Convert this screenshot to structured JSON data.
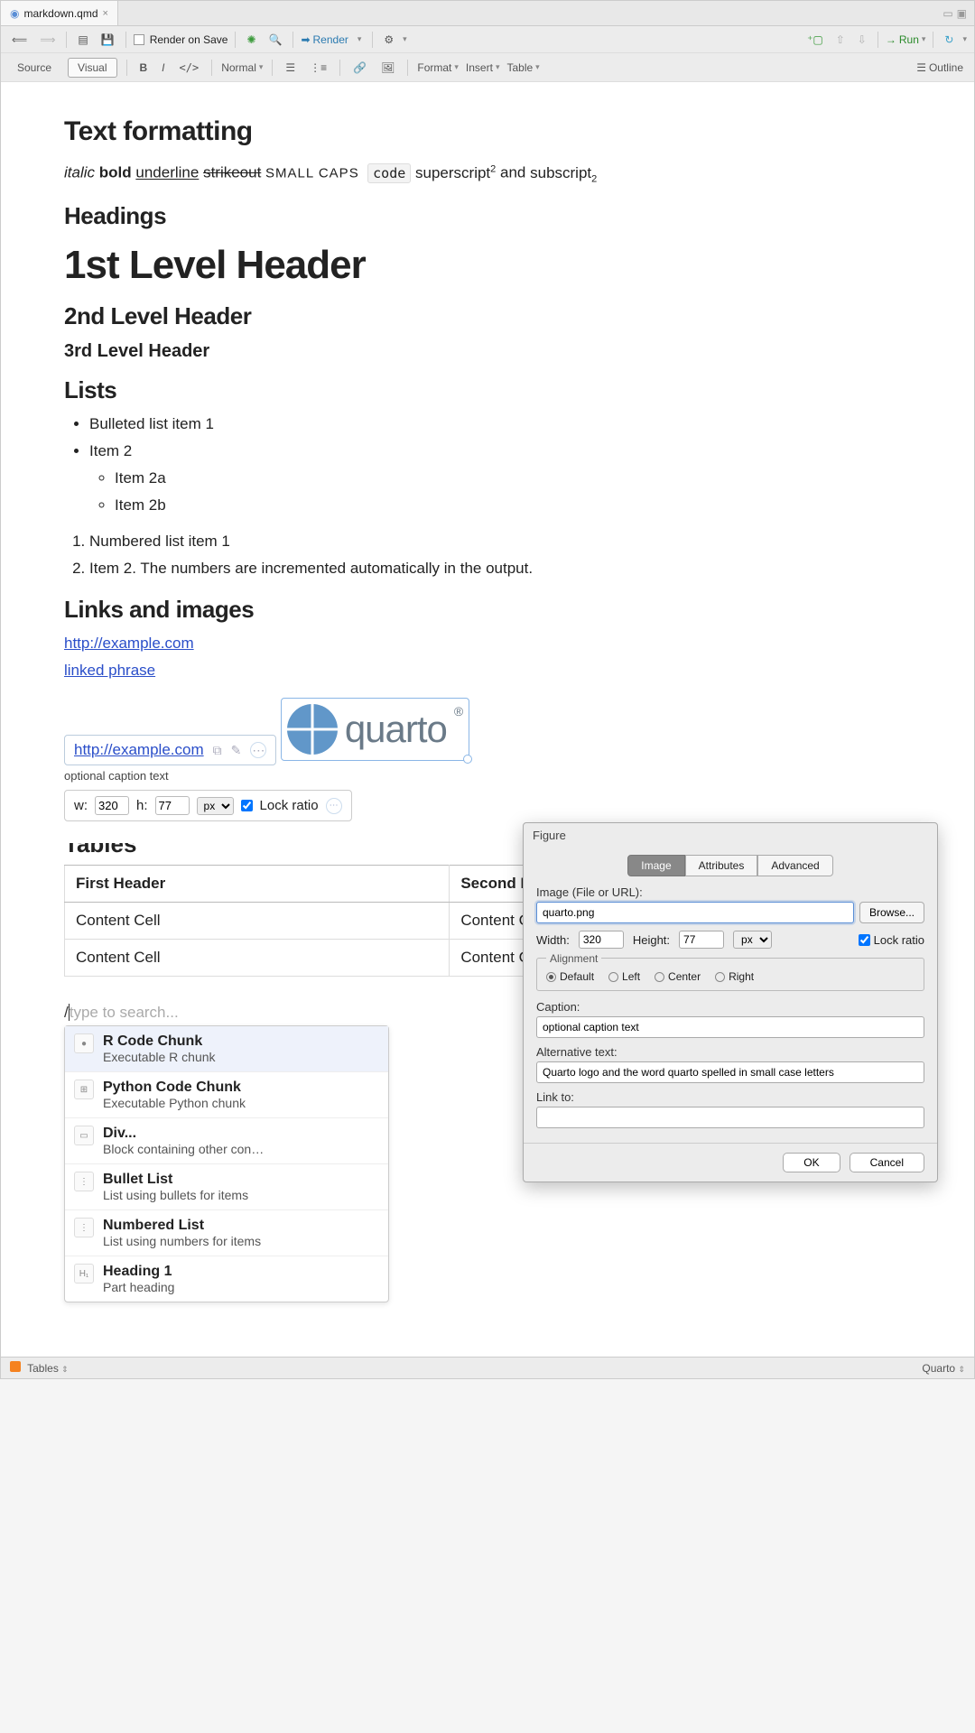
{
  "tab": {
    "filename": "markdown.qmd"
  },
  "toolbar1": {
    "render_on_save": "Render on Save",
    "render": "Render",
    "run": "Run"
  },
  "toolbar2": {
    "source": "Source",
    "visual": "Visual",
    "normal": "Normal",
    "format": "Format",
    "insert": "Insert",
    "table": "Table",
    "outline": "Outline"
  },
  "doc": {
    "h_text_formatting": "Text formatting",
    "fmt": {
      "italic": "italic",
      "bold": "bold",
      "underline": "underline",
      "strikeout": "strikeout",
      "smallcaps": "SMALL CAPS",
      "code": "code",
      "superscript_word": "superscript",
      "superscript_n": "2",
      "and": " and ",
      "subscript_word": "subscript",
      "subscript_n": "2"
    },
    "h_headings": "Headings",
    "h1": "1st Level Header",
    "h2": "2nd Level Header",
    "h3": "3rd Level Header",
    "h_lists": "Lists",
    "ul": [
      "Bulleted list item 1",
      "Item 2"
    ],
    "ul_sub": [
      "Item 2a",
      "Item 2b"
    ],
    "ol": [
      "Numbered list item 1",
      "Item 2. The numbers are incremented automatically in the output."
    ],
    "h_links": "Links and images",
    "link1": "http://example.com",
    "link2": "linked phrase",
    "link3": "http://example.com",
    "quarto_text": "quarto",
    "caption": "optional caption text",
    "sizebar": {
      "w_label": "w:",
      "w": "320",
      "h_label": "h:",
      "h": "77",
      "unit": "px",
      "lock": "Lock ratio"
    },
    "h_tables": "Tables",
    "table": {
      "headers": [
        "First Header",
        "Second Header"
      ],
      "rows": [
        [
          "Content Cell",
          "Content Cell"
        ],
        [
          "Content Cell",
          "Content Cell"
        ]
      ]
    },
    "slash_prefix": "/",
    "slash_placeholder": "type to search...",
    "cmds": [
      {
        "title": "R Code Chunk",
        "desc": "Executable R chunk",
        "icon": "●"
      },
      {
        "title": "Python Code Chunk",
        "desc": "Executable Python chunk",
        "icon": "⊞"
      },
      {
        "title": "Div...",
        "desc": "Block containing other con…",
        "icon": "▭"
      },
      {
        "title": "Bullet List",
        "desc": "List using bullets for items",
        "icon": "⋮"
      },
      {
        "title": "Numbered List",
        "desc": "List using numbers for items",
        "icon": "⋮"
      },
      {
        "title": "Heading 1",
        "desc": "Part heading",
        "icon": "H₁"
      }
    ]
  },
  "dialog": {
    "title": "Figure",
    "tabs": [
      "Image",
      "Attributes",
      "Advanced"
    ],
    "image_label": "Image (File or URL):",
    "image_value": "quarto.png",
    "browse": "Browse...",
    "width_label": "Width:",
    "width": "320",
    "height_label": "Height:",
    "height": "77",
    "unit": "px",
    "lock": "Lock ratio",
    "align_legend": "Alignment",
    "align": [
      "Default",
      "Left",
      "Center",
      "Right"
    ],
    "caption_label": "Caption:",
    "caption_value": "optional caption text",
    "alt_label": "Alternative text:",
    "alt_value": "Quarto logo and the word quarto spelled in small case letters",
    "linkto_label": "Link to:",
    "linkto_value": "",
    "ok": "OK",
    "cancel": "Cancel"
  },
  "statusbar": {
    "left": "Tables",
    "right": "Quarto"
  }
}
